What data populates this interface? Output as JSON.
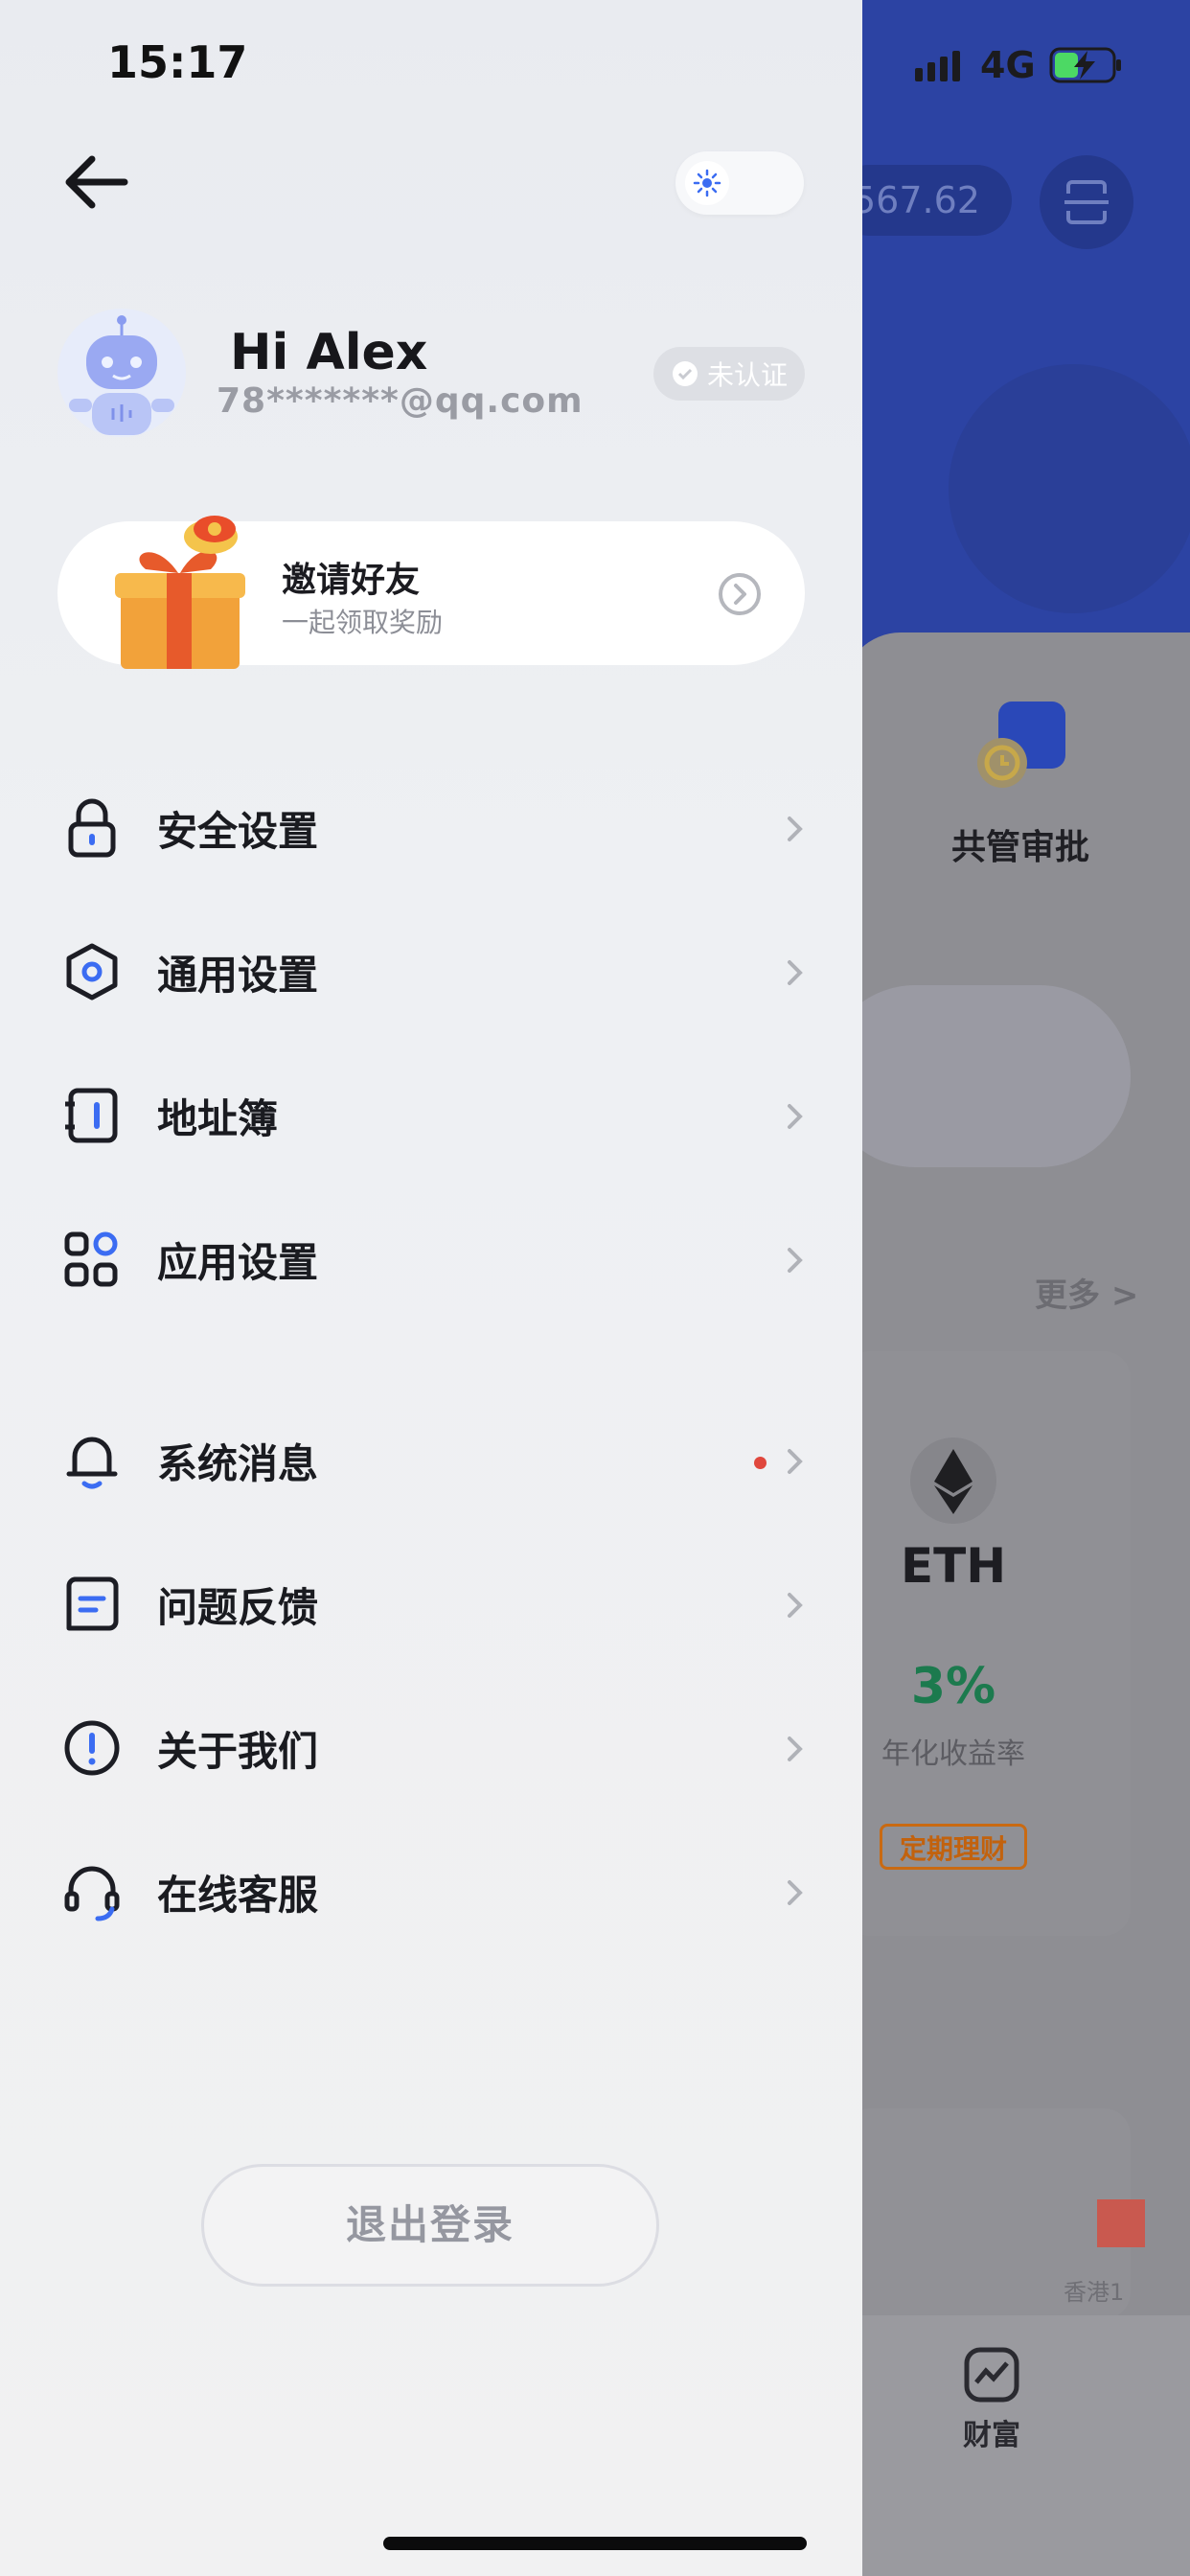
{
  "status_bar": {
    "time": "15:17",
    "network": "4G"
  },
  "drawer": {
    "greeting": "Hi Alex",
    "email": "78*******@qq.com",
    "verify_badge": "未认证",
    "invite": {
      "title": "邀请好友",
      "subtitle": "一起领取奖励"
    },
    "menu_group_1": [
      {
        "label": "安全设置",
        "icon": "lock-icon"
      },
      {
        "label": "通用设置",
        "icon": "hexagon-settings-icon"
      },
      {
        "label": "地址簿",
        "icon": "address-book-icon"
      },
      {
        "label": "应用设置",
        "icon": "apps-grid-icon"
      }
    ],
    "menu_group_2": [
      {
        "label": "系统消息",
        "icon": "bell-icon",
        "unread": true
      },
      {
        "label": "问题反馈",
        "icon": "feedback-icon"
      },
      {
        "label": "关于我们",
        "icon": "info-icon"
      },
      {
        "label": "在线客服",
        "icon": "headset-icon"
      }
    ],
    "logout_label": "退出登录"
  },
  "background_app": {
    "balance_fragment": "567.62",
    "shortcut_label": "共管审批",
    "more_label": "更多 >",
    "product": {
      "coin": "ETH",
      "rate": "3%",
      "rate_label": "年化收益率",
      "tag": "定期理财"
    },
    "card2_label": "香港1",
    "tab_wealth": "财富"
  },
  "colors": {
    "accent": "#3b6cf2",
    "hero_blue": "#2c43a3",
    "unread_dot": "#e0473d",
    "green_rate": "#1c7a4e",
    "tag_orange": "#c2620e"
  }
}
